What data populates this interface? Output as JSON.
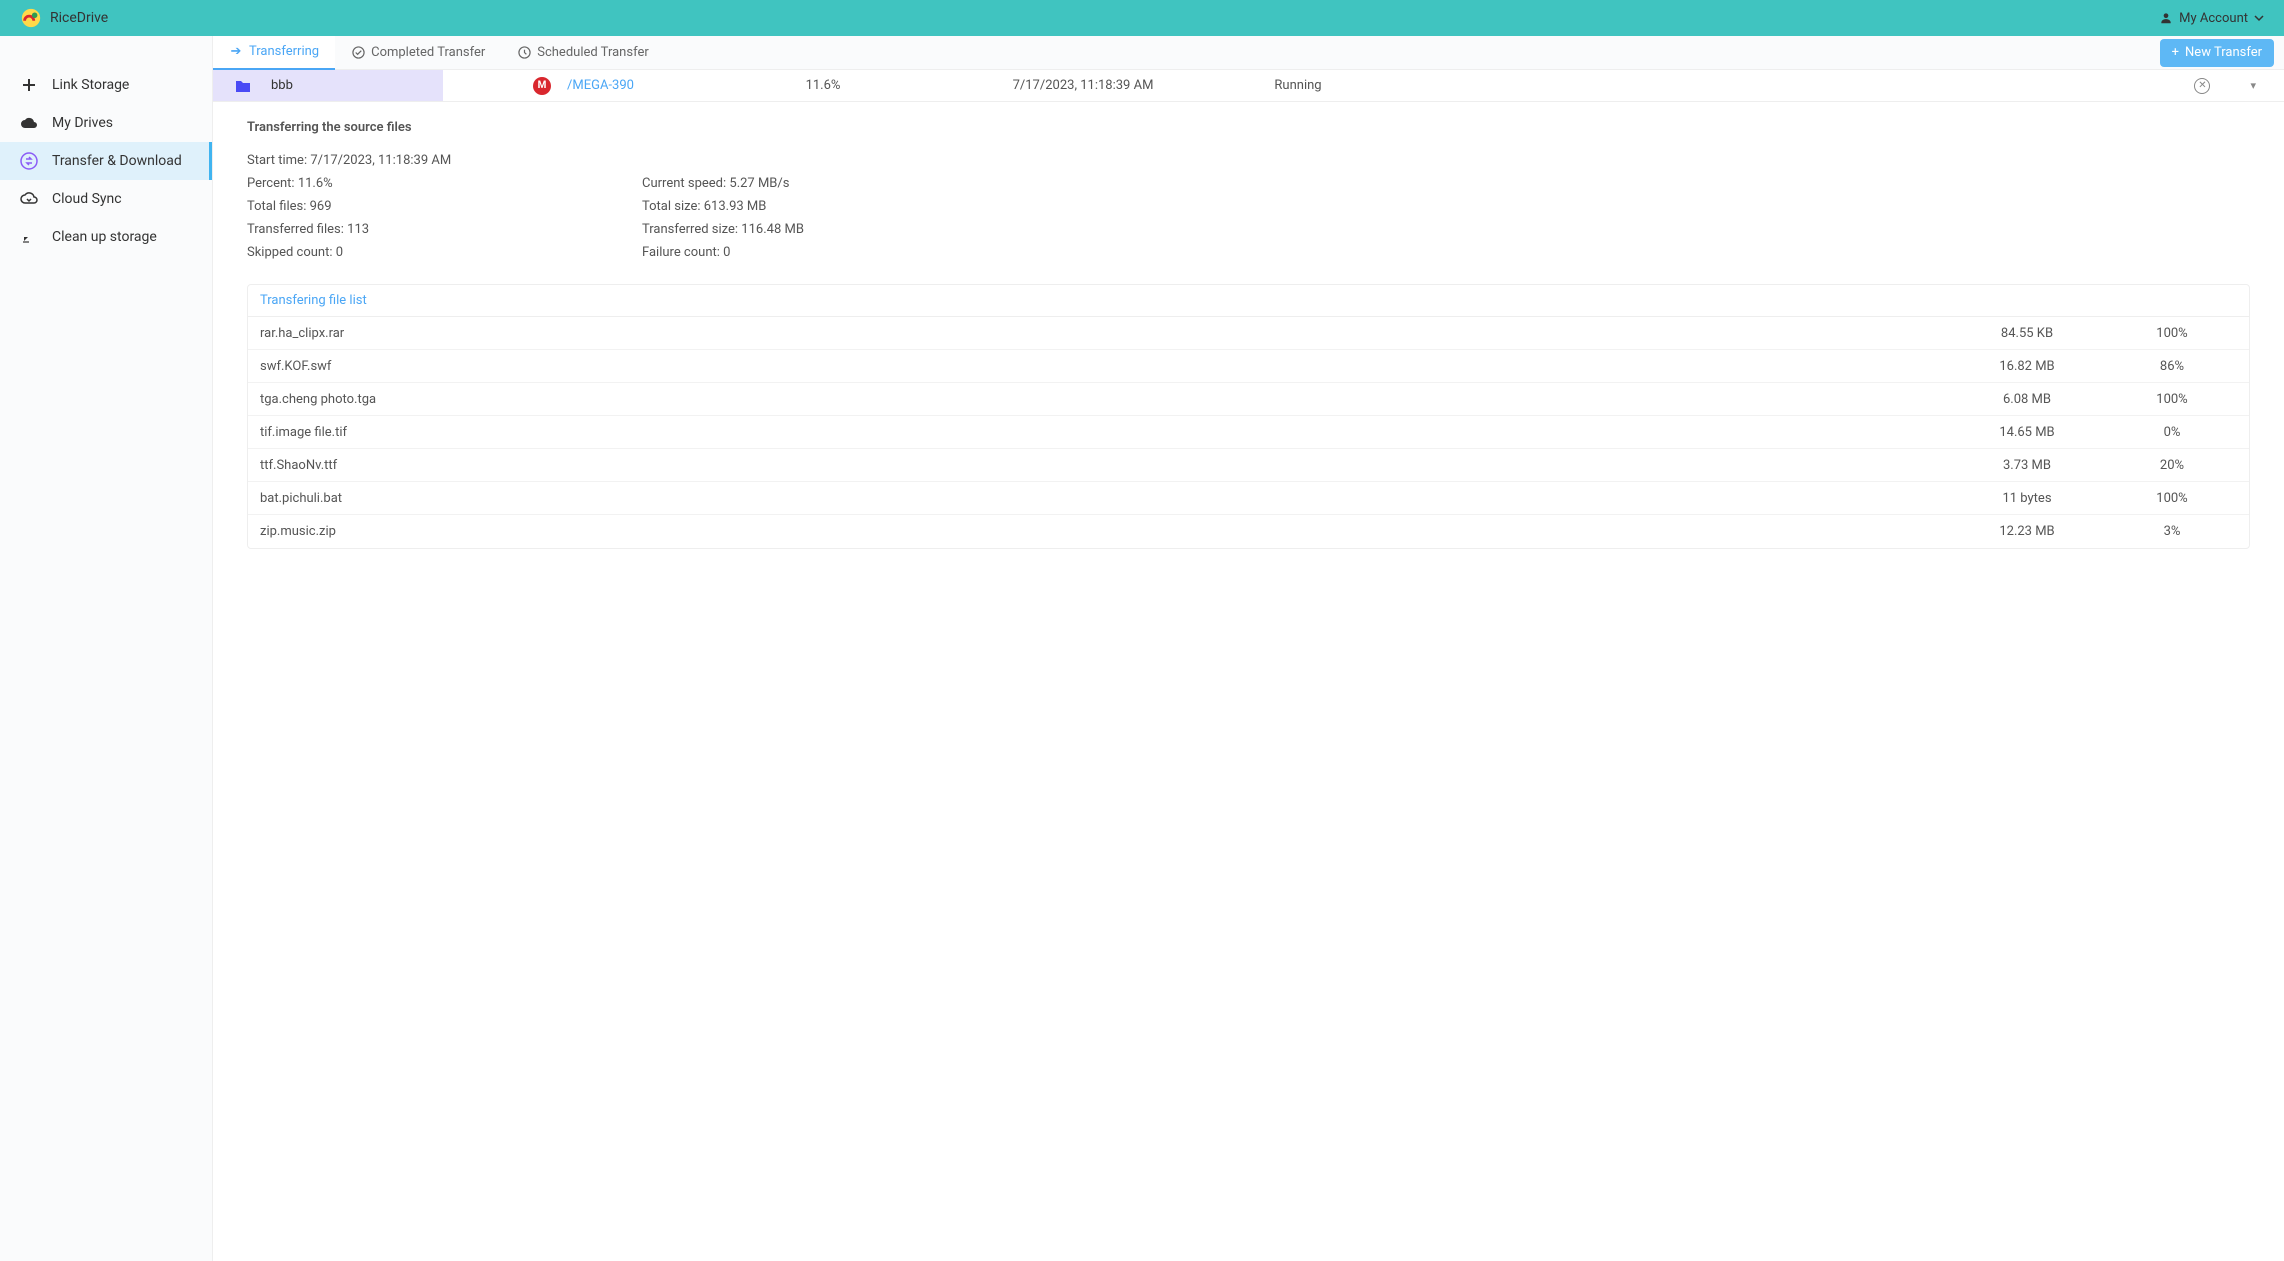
{
  "header": {
    "brand": "RiceDrive",
    "account_label": "My Account"
  },
  "sidebar": {
    "items": [
      {
        "label": "Link Storage"
      },
      {
        "label": "My Drives"
      },
      {
        "label": "Transfer & Download"
      },
      {
        "label": "Cloud Sync"
      },
      {
        "label": "Clean up storage"
      }
    ]
  },
  "tabs": {
    "transferring": "Transferring",
    "completed": "Completed Transfer",
    "scheduled": "Scheduled Transfer"
  },
  "new_transfer_label": "New Transfer",
  "transfer_row": {
    "source_name": "bbb",
    "dest_name": "/MEGA-390",
    "percent": "11.6%",
    "time": "7/17/2023, 11:18:39 AM",
    "status": "Running"
  },
  "details": {
    "title": "Transferring the source files",
    "start_time_label": "Start time:",
    "start_time": "7/17/2023, 11:18:39 AM",
    "percent_label": "Percent:",
    "percent": "11.6%",
    "total_files_label": "Total files:",
    "total_files": "969",
    "transferred_files_label": "Transferred files:",
    "transferred_files": "113",
    "skipped_label": "Skipped count:",
    "skipped": "0",
    "speed_label": "Current speed:",
    "speed": "5.27 MB/s",
    "total_size_label": "Total size:",
    "total_size": "613.93 MB",
    "transferred_size_label": "Transferred size:",
    "transferred_size": "116.48 MB",
    "failure_label": "Failure count:",
    "failure": "0"
  },
  "file_list": {
    "header": "Transfering file list",
    "rows": [
      {
        "name": "rar.ha_clipx.rar",
        "size": "84.55 KB",
        "pct": "100%"
      },
      {
        "name": "swf.KOF.swf",
        "size": "16.82 MB",
        "pct": "86%"
      },
      {
        "name": "tga.cheng photo.tga",
        "size": "6.08 MB",
        "pct": "100%"
      },
      {
        "name": "tif.image file.tif",
        "size": "14.65 MB",
        "pct": "0%"
      },
      {
        "name": "ttf.ShaoNv.ttf",
        "size": "3.73 MB",
        "pct": "20%"
      },
      {
        "name": "bat.pichuli.bat",
        "size": "11 bytes",
        "pct": "100%"
      },
      {
        "name": "zip.music.zip",
        "size": "12.23 MB",
        "pct": "3%"
      }
    ]
  }
}
